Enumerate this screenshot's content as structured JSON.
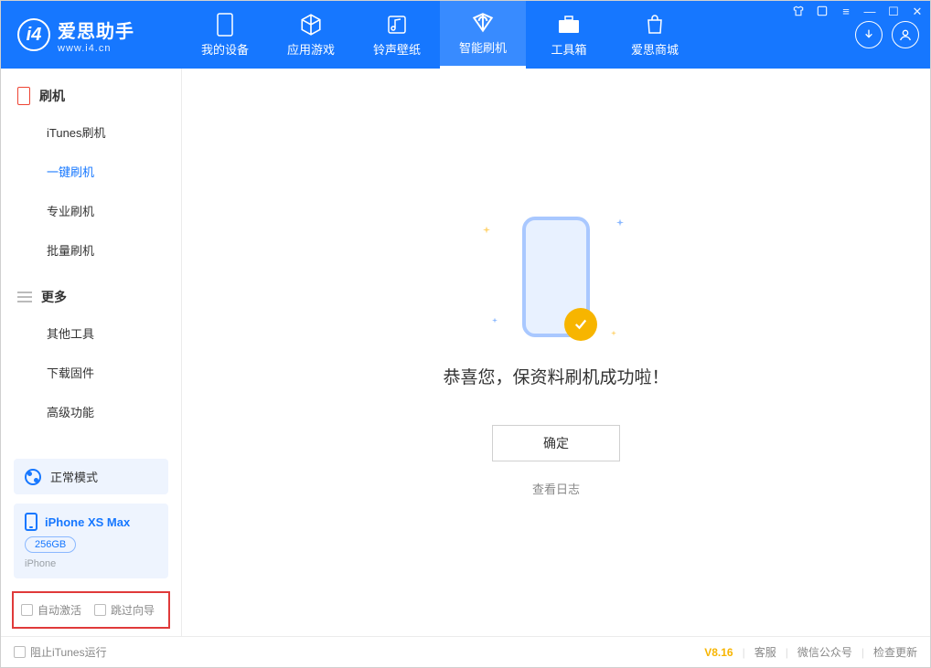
{
  "app": {
    "name": "爱思助手",
    "url": "www.i4.cn"
  },
  "nav": [
    {
      "label": "我的设备",
      "icon": "device"
    },
    {
      "label": "应用游戏",
      "icon": "cube"
    },
    {
      "label": "铃声壁纸",
      "icon": "music"
    },
    {
      "label": "智能刷机",
      "icon": "refresh",
      "active": true
    },
    {
      "label": "工具箱",
      "icon": "toolbox"
    },
    {
      "label": "爱思商城",
      "icon": "shop"
    }
  ],
  "sidebar": {
    "section1_title": "刷机",
    "section1_items": [
      "iTunes刷机",
      "一键刷机",
      "专业刷机",
      "批量刷机"
    ],
    "section1_active_index": 1,
    "section2_title": "更多",
    "section2_items": [
      "其他工具",
      "下载固件",
      "高级功能"
    ],
    "mode_label": "正常模式",
    "device": {
      "name": "iPhone XS Max",
      "storage": "256GB",
      "type": "iPhone"
    },
    "check1": "自动激活",
    "check2": "跳过向导"
  },
  "main": {
    "success_message": "恭喜您，保资料刷机成功啦！",
    "ok_button": "确定",
    "view_log": "查看日志"
  },
  "statusbar": {
    "block_itunes": "阻止iTunes运行",
    "version": "V8.16",
    "support": "客服",
    "wechat": "微信公众号",
    "update": "检查更新"
  }
}
